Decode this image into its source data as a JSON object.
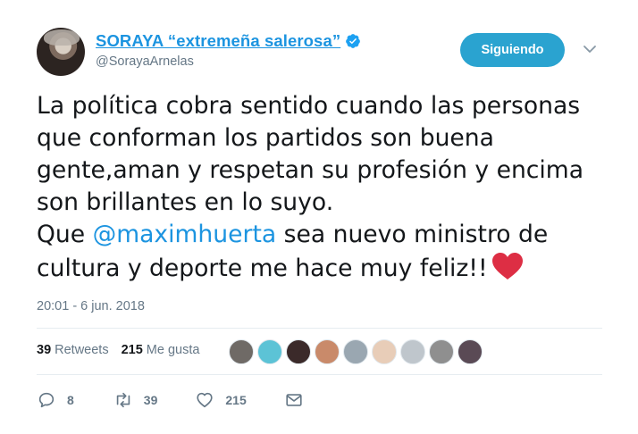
{
  "user": {
    "display_name": "SORAYA “extremeña salerosa”",
    "handle": "@SorayaArnelas",
    "verified": true
  },
  "follow_button": {
    "label": "Siguiendo"
  },
  "tweet": {
    "lines": [
      "La política cobra sentido cuando las personas",
      "que conforman los partidos son buena",
      "gente,aman y respetan su profesión y encima",
      "son brillantes en lo suyo."
    ],
    "line5_prefix": "Que ",
    "mention": "@maximhuerta",
    "line5_suffix": " sea nuevo ministro de",
    "line6": "cultura  y deporte me hace muy feliz!!"
  },
  "timestamp": "20:01 - 6 jun. 2018",
  "stats": {
    "retweets_count": "39",
    "retweets_label": "Retweets",
    "likes_count": "215",
    "likes_label": "Me gusta"
  },
  "likers": [
    {
      "color": "#6f6a66"
    },
    {
      "color": "#5cc3d6"
    },
    {
      "color": "#3b2a2a"
    },
    {
      "color": "#c98a6a"
    },
    {
      "color": "#9aa7b1"
    },
    {
      "color": "#e8cdb8"
    },
    {
      "color": "#bfc6cc"
    },
    {
      "color": "#8f8f8f"
    },
    {
      "color": "#5a4a55"
    }
  ],
  "actions": {
    "reply_count": "8",
    "retweet_count": "39",
    "like_count": "215"
  },
  "colors": {
    "link": "#1c94e0",
    "follow_bg": "#2aa3d0",
    "heart": "#e0245e",
    "muted": "#657786"
  }
}
